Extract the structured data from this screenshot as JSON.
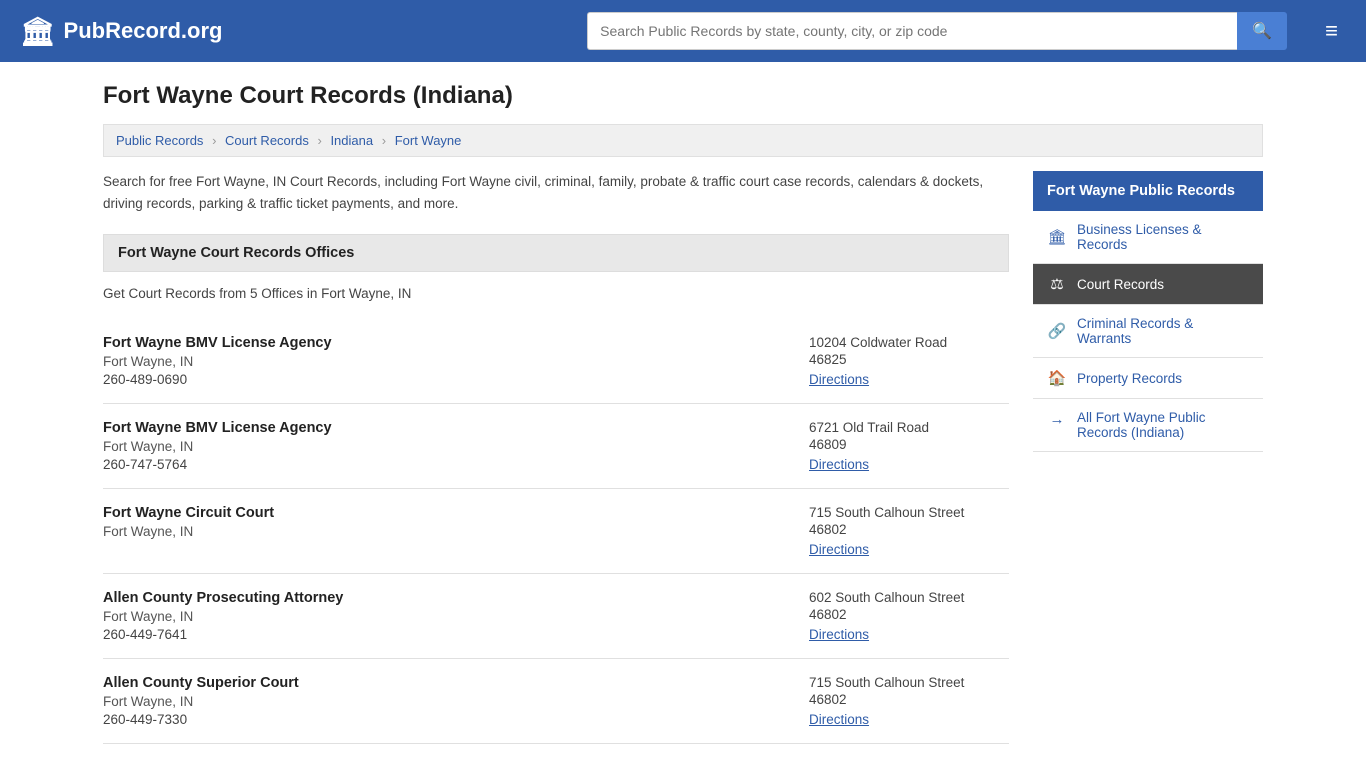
{
  "header": {
    "logo_text": "PubRecord.org",
    "search_placeholder": "Search Public Records by state, county, city, or zip code",
    "search_icon": "🔍",
    "menu_icon": "≡"
  },
  "page": {
    "title": "Fort Wayne Court Records (Indiana)",
    "intro": "Search for free Fort Wayne, IN Court Records, including Fort Wayne civil, criminal, family, probate & traffic court case records, calendars & dockets, driving records, parking & traffic ticket payments, and more."
  },
  "breadcrumb": {
    "items": [
      {
        "label": "Public Records",
        "href": "#"
      },
      {
        "label": "Court Records",
        "href": "#"
      },
      {
        "label": "Indiana",
        "href": "#"
      },
      {
        "label": "Fort Wayne",
        "href": "#"
      }
    ]
  },
  "section": {
    "heading": "Fort Wayne Court Records Offices",
    "count_text": "Get Court Records from 5 Offices in Fort Wayne, IN"
  },
  "offices": [
    {
      "name": "Fort Wayne BMV License Agency",
      "city": "Fort Wayne, IN",
      "phone": "260-489-0690",
      "address": "10204 Coldwater Road",
      "zip": "46825",
      "directions_label": "Directions"
    },
    {
      "name": "Fort Wayne BMV License Agency",
      "city": "Fort Wayne, IN",
      "phone": "260-747-5764",
      "address": "6721 Old Trail Road",
      "zip": "46809",
      "directions_label": "Directions"
    },
    {
      "name": "Fort Wayne Circuit Court",
      "city": "Fort Wayne, IN",
      "phone": "",
      "address": "715 South Calhoun Street",
      "zip": "46802",
      "directions_label": "Directions"
    },
    {
      "name": "Allen County Prosecuting Attorney",
      "city": "Fort Wayne, IN",
      "phone": "260-449-7641",
      "address": "602 South Calhoun Street",
      "zip": "46802",
      "directions_label": "Directions"
    },
    {
      "name": "Allen County Superior Court",
      "city": "Fort Wayne, IN",
      "phone": "260-449-7330",
      "address": "715 South Calhoun Street",
      "zip": "46802",
      "directions_label": "Directions"
    }
  ],
  "sidebar": {
    "title": "Fort Wayne Public Records",
    "items": [
      {
        "id": "business",
        "icon": "🏛",
        "label": "Business Licenses & Records",
        "active": false
      },
      {
        "id": "court",
        "icon": "⚖",
        "label": "Court Records",
        "active": true
      },
      {
        "id": "criminal",
        "icon": "🔗",
        "label": "Criminal Records & Warrants",
        "active": false
      },
      {
        "id": "property",
        "icon": "🏠",
        "label": "Property Records",
        "active": false
      }
    ],
    "all_link_label": "All Fort Wayne Public Records (Indiana)"
  }
}
